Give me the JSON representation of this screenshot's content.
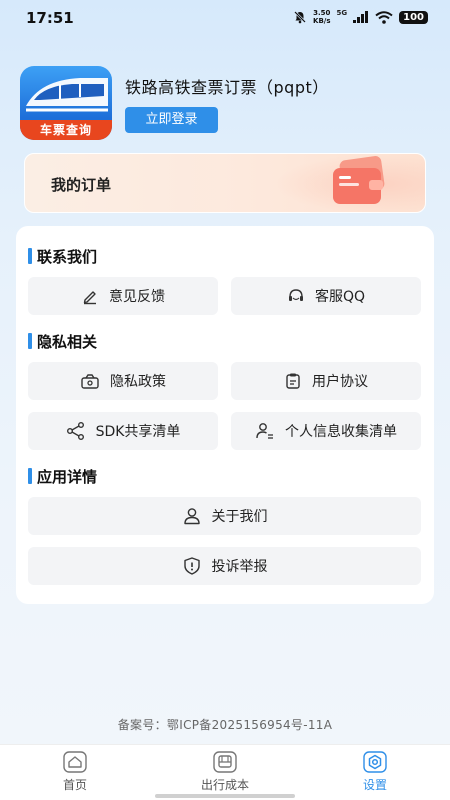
{
  "status_bar": {
    "time": "17:51",
    "net_speed_value": "3.50",
    "net_speed_unit": "KB/s",
    "signal_label": "5G",
    "battery": "100"
  },
  "header": {
    "app_title": "铁路高铁查票订票（pqpt）",
    "logo_banner": "车票查询",
    "login_button": "立即登录"
  },
  "orders": {
    "title": "我的订单"
  },
  "sections": {
    "contact": {
      "title": "联系我们",
      "feedback": "意见反馈",
      "service_qq": "客服QQ"
    },
    "privacy": {
      "title": "隐私相关",
      "privacy_policy": "隐私政策",
      "user_agreement": "用户协议",
      "sdk_list": "SDK共享清单",
      "personal_info_list": "个人信息收集清单"
    },
    "app_details": {
      "title": "应用详情",
      "about_us": "关于我们",
      "complaint": "投诉举报"
    }
  },
  "icp": "备案号：鄂ICP备2025156954号-11A",
  "bottom_nav": {
    "home": "首页",
    "travel_cost": "出行成本",
    "settings": "设置",
    "active": "settings"
  },
  "colors": {
    "accent": "#2f8fe8",
    "logo_red": "#e8461e"
  }
}
